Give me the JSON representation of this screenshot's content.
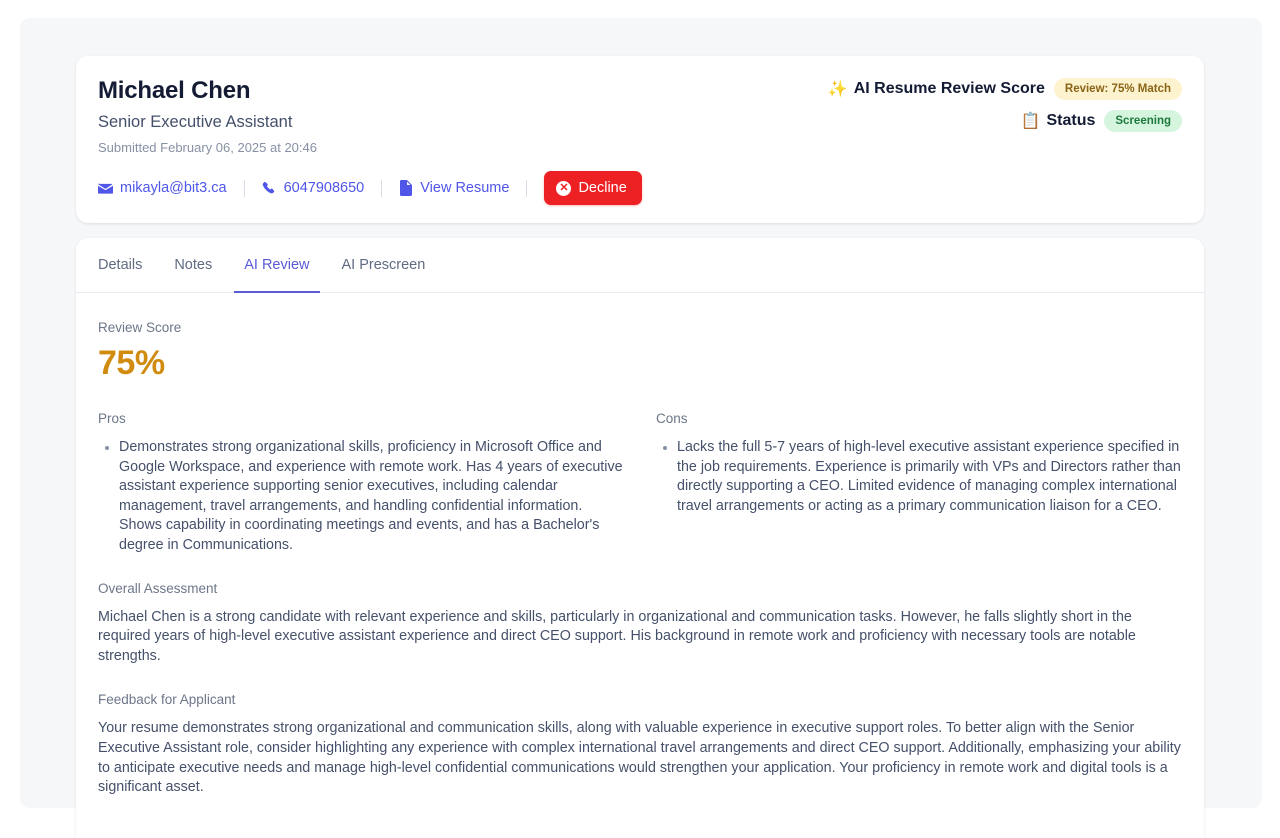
{
  "candidate": {
    "name": "Michael Chen",
    "role": "Senior Executive Assistant",
    "submitted": "Submitted February 06, 2025 at 20:46",
    "email": "mikayla@bit3.ca",
    "phone": "6047908650",
    "view_resume_label": "View Resume",
    "decline_label": "Decline"
  },
  "header_right": {
    "score_title": "AI Resume Review Score",
    "score_badge": "Review: 75% Match",
    "status_title": "Status",
    "status_badge": "Screening",
    "sparkle_emoji": "✨",
    "clipboard_emoji": "📋"
  },
  "tabs": [
    {
      "label": "Details",
      "active": false
    },
    {
      "label": "Notes",
      "active": false
    },
    {
      "label": "AI Review",
      "active": true
    },
    {
      "label": "AI Prescreen",
      "active": false
    }
  ],
  "review": {
    "score_label": "Review Score",
    "score_value": "75%",
    "pros_label": "Pros",
    "pros": [
      "Demonstrates strong organizational skills, proficiency in Microsoft Office and Google Workspace, and experience with remote work. Has 4 years of executive assistant experience supporting senior executives, including calendar management, travel arrangements, and handling confidential information. Shows capability in coordinating meetings and events, and has a Bachelor's degree in Communications."
    ],
    "cons_label": "Cons",
    "cons": [
      "Lacks the full 5-7 years of high-level executive assistant experience specified in the job requirements. Experience is primarily with VPs and Directors rather than directly supporting a CEO. Limited evidence of managing complex international travel arrangements or acting as a primary communication liaison for a CEO."
    ],
    "overall_label": "Overall Assessment",
    "overall_text": "Michael Chen is a strong candidate with relevant experience and skills, particularly in organizational and communication tasks. However, he falls slightly short in the required years of high-level executive assistant experience and direct CEO support. His background in remote work and proficiency with necessary tools are notable strengths.",
    "feedback_label": "Feedback for Applicant",
    "feedback_text": "Your resume demonstrates strong organizational and communication skills, along with valuable experience in executive support roles. To better align with the Senior Executive Assistant role, consider highlighting any experience with complex international travel arrangements and direct CEO support. Additionally, emphasizing your ability to anticipate executive needs and manage high-level confidential communications would strengthen your application. Your proficiency in remote work and digital tools is a significant asset."
  },
  "colors": {
    "accent": "#4f56e8",
    "tab_active": "#5b5bd6",
    "score": "#d18c10",
    "danger": "#ed2024",
    "badge_review_bg": "#fdf3ce",
    "badge_status_bg": "#d6f5df"
  }
}
